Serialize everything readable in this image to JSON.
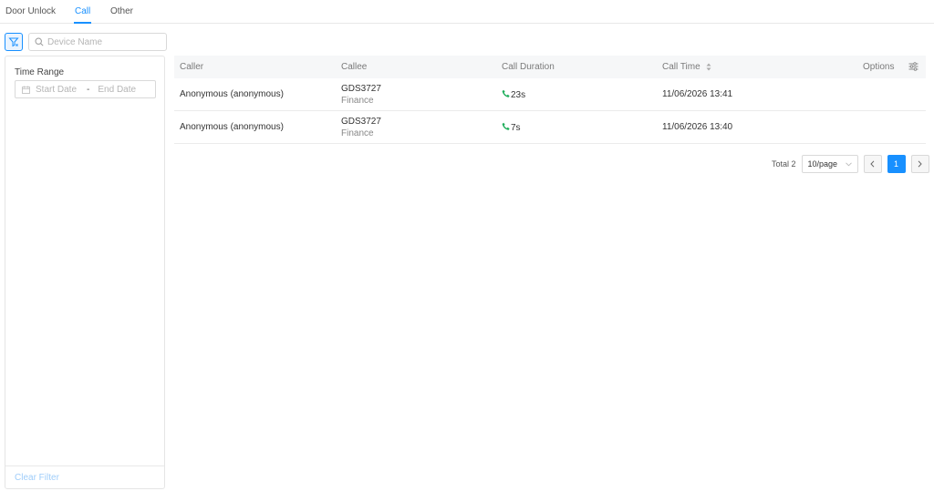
{
  "tabs": [
    {
      "label": "Door Unlock",
      "active": false
    },
    {
      "label": "Call",
      "active": true
    },
    {
      "label": "Other",
      "active": false
    }
  ],
  "search": {
    "placeholder": "Device Name",
    "value": ""
  },
  "filter": {
    "time_range_label": "Time Range",
    "start_placeholder": "Start Date",
    "separator": "-",
    "end_placeholder": "End Date",
    "clear_label": "Clear Filter"
  },
  "table": {
    "columns": {
      "caller": "Caller",
      "callee": "Callee",
      "duration": "Call Duration",
      "time": "Call Time",
      "options": "Options"
    },
    "rows": [
      {
        "caller": "Anonymous (anonymous)",
        "callee": "GDS3727",
        "callee_group": "Finance",
        "duration": "23s",
        "time": "11/06/2026 13:41"
      },
      {
        "caller": "Anonymous (anonymous)",
        "callee": "GDS3727",
        "callee_group": "Finance",
        "duration": "7s",
        "time": "11/06/2026 13:40"
      }
    ]
  },
  "pagination": {
    "total": "Total 2",
    "page_size": "10/page",
    "current_page": "1"
  },
  "icons": {
    "filter": "filter-icon",
    "search": "search-icon",
    "calendar": "calendar-icon",
    "phone": "phone-icon",
    "sort": "sort-icon",
    "settings": "column-settings-icon"
  },
  "colors": {
    "accent": "#1890ff",
    "call_icon": "#1fae5b"
  }
}
